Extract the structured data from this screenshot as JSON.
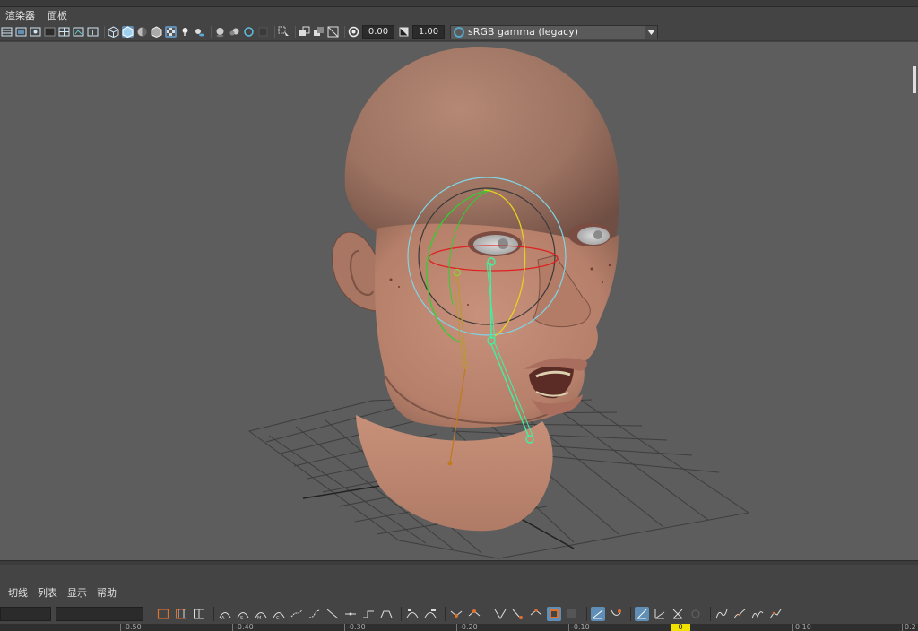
{
  "menubar": {
    "items": [
      "渲染器",
      "面板"
    ]
  },
  "toolbar": {
    "exposure_value": "0.00",
    "gamma_value": "1.00",
    "color_management": "sRGB gamma (legacy)"
  },
  "graph_editor": {
    "menu": [
      "切线",
      "列表",
      "显示",
      "帮助"
    ],
    "ruler_ticks": [
      "-0.50",
      "-0.40",
      "-0.30",
      "-0.20",
      "-0.10",
      "0",
      "0.10",
      "0.2"
    ],
    "current_time_label": "0"
  }
}
